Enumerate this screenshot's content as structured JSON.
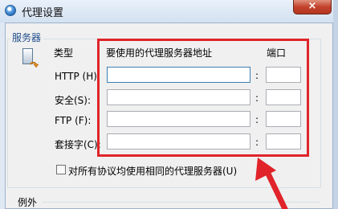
{
  "window": {
    "title": "代理设置",
    "close_label": "×"
  },
  "servers": {
    "group_label": "服务器",
    "type_header": "类型",
    "address_header": "要使用的代理服务器地址",
    "port_header": "端口",
    "colon": ":",
    "rows": [
      {
        "label": "HTTP (H):",
        "address": "",
        "port": ""
      },
      {
        "label": "安全(S):",
        "address": "",
        "port": ""
      },
      {
        "label": "FTP (F):",
        "address": "",
        "port": ""
      },
      {
        "label": "套接字(C):",
        "address": "",
        "port": ""
      }
    ],
    "same_proxy_label": "对所有协议均使用相同的代理服务器(U)",
    "same_proxy_checked": false
  },
  "exceptions": {
    "group_label": "例外"
  },
  "annotation": {
    "color": "#e0242a"
  }
}
